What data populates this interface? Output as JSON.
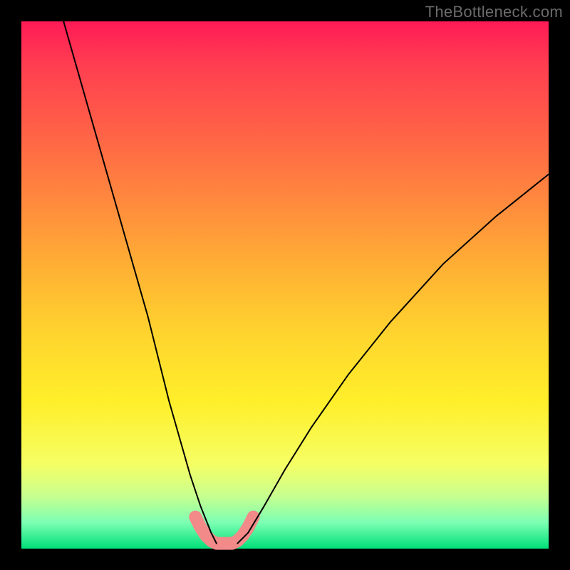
{
  "watermark": "TheBottleneck.com",
  "chart_data": {
    "type": "line",
    "title": "",
    "xlabel": "",
    "ylabel": "",
    "xlim": [
      0,
      100
    ],
    "ylim": [
      0,
      100
    ],
    "series": [
      {
        "name": "left-curve",
        "x": [
          8,
          12,
          16,
          20,
          24,
          26,
          28,
          30,
          32,
          34,
          36,
          37
        ],
        "y": [
          100,
          86,
          72,
          58,
          44,
          36,
          28,
          21,
          14,
          8,
          3,
          1
        ]
      },
      {
        "name": "right-curve",
        "x": [
          41,
          43,
          46,
          50,
          55,
          62,
          70,
          80,
          90,
          100
        ],
        "y": [
          1,
          3,
          8,
          15,
          23,
          33,
          43,
          54,
          63,
          71
        ]
      },
      {
        "name": "bottom-band",
        "x": [
          33,
          34,
          35,
          36,
          37,
          38,
          39,
          40,
          41,
          42,
          43,
          44
        ],
        "y": [
          6,
          4,
          2.5,
          1.5,
          1,
          1,
          1,
          1,
          1.5,
          2.5,
          4,
          6
        ]
      }
    ],
    "band_color": "#f28a8a",
    "curve_color": "#000000",
    "curve_width": 2,
    "band_width": 18
  }
}
